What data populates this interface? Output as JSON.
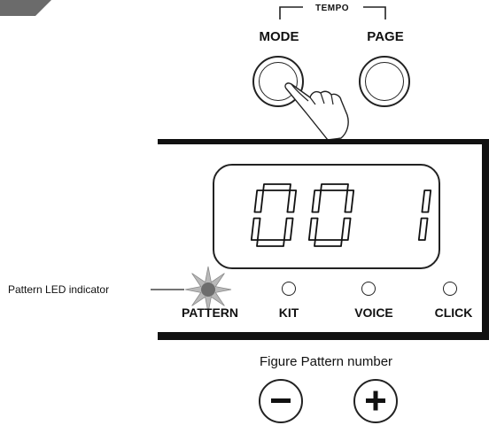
{
  "buttons": {
    "tempo_label": "TEMPO",
    "mode_label": "MODE",
    "page_label": "PAGE"
  },
  "display": {
    "digits": [
      "0",
      "0",
      "1"
    ]
  },
  "indicators": [
    {
      "label": "PATTERN",
      "lit": true
    },
    {
      "label": "KIT",
      "lit": false
    },
    {
      "label": "VOICE",
      "lit": false
    },
    {
      "label": "CLICK",
      "lit": false
    }
  ],
  "annotation": {
    "led": "Pattern LED indicator"
  },
  "caption": {
    "figure": "Figure Pattern number"
  },
  "controls": {
    "minus": "minus-button",
    "plus": "plus-button"
  }
}
